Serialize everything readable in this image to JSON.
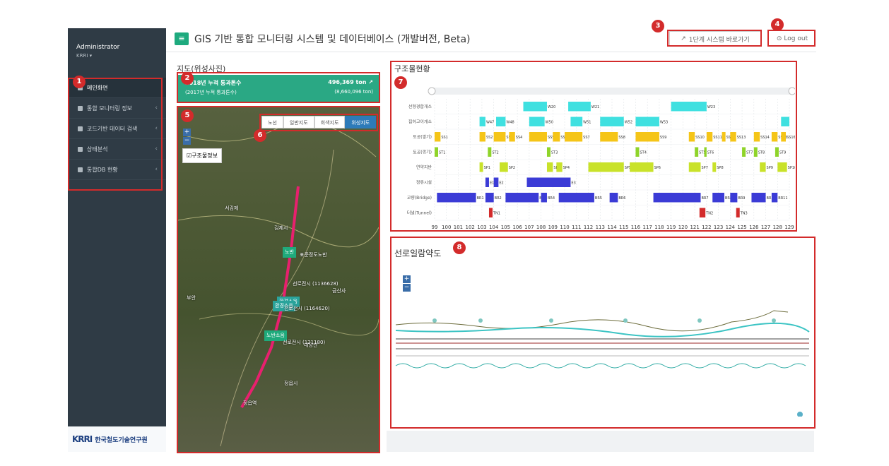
{
  "sidebar": {
    "user_name": "Administrator",
    "user_sub": "KRRI ▾",
    "items": [
      {
        "label": "메인화면"
      },
      {
        "label": "통합 모니터링 정보"
      },
      {
        "label": "코드기반 데이터 검색"
      },
      {
        "label": "상태분석"
      },
      {
        "label": "통합DB 현황"
      }
    ],
    "logo_mark": "KRRI",
    "logo_text": "한국철도기술연구원"
  },
  "header": {
    "menu_icon": "hamburger-icon",
    "title": "GIS 기반 통합 모니터링 시스템 및 데이터베이스 (개발버전, Beta)",
    "shortcut_label": "1단계 시스템 바로가기",
    "logout_label": "Log out"
  },
  "map_section": {
    "title": "지도(위성사진)",
    "stats_label": "2018년 누적 통과톤수",
    "stats_value": "496,369 ton",
    "stats_prev_label": "(2017년 누적 통과톤수)",
    "stats_prev_value": "(8,660,096 ton)",
    "tabs": [
      "노선",
      "일반지도",
      "회색지도",
      "위성지도"
    ],
    "active_tab": "위성지도",
    "checkbox_label": "구조물정보",
    "places": [
      "김제시",
      "정읍시",
      "정읍역",
      "부안",
      "내장산",
      "서김제",
      "금산사"
    ],
    "badges": [
      "노반",
      "환경소음",
      "환경소음",
      "노반소음"
    ],
    "annotations": [
      "표준정도노반",
      "선로전시 (1136628)",
      "선로전시 (1164620)",
      "선로전시 (121180)"
    ]
  },
  "structure_section": {
    "title": "구조물현황"
  },
  "lineplan_section": {
    "title": "선로일람약도"
  },
  "callouts": [
    "1",
    "2",
    "3",
    "4",
    "5",
    "6",
    "7",
    "8"
  ],
  "chart_data": {
    "type": "gantt",
    "x_range": [
      99,
      129
    ],
    "x_ticks": [
      "99",
      "100",
      "101",
      "102",
      "103",
      "104",
      "105",
      "106",
      "107",
      "108",
      "109",
      "110",
      "111",
      "112",
      "113",
      "114",
      "115",
      "116",
      "117",
      "118",
      "119",
      "120",
      "121",
      "122",
      "123",
      "124",
      "125",
      "126",
      "127",
      "128",
      "129"
    ],
    "rows": [
      {
        "name": "선형경합개소",
        "color": "#3fe0e0",
        "items": [
          {
            "label": "W20",
            "start": 106.5,
            "end": 108.5
          },
          {
            "label": "W21",
            "start": 110.3,
            "end": 112.2
          },
          {
            "label": "W23",
            "start": 119,
            "end": 122
          }
        ]
      },
      {
        "name": "집하고이개소",
        "color": "#3fe0e0",
        "items": [
          {
            "label": "W47",
            "start": 102.8,
            "end": 103.3
          },
          {
            "label": "W48",
            "start": 104.2,
            "end": 105
          },
          {
            "label": "W50",
            "start": 107,
            "end": 108.3
          },
          {
            "label": "W51",
            "start": 110.5,
            "end": 111.5
          },
          {
            "label": "W52",
            "start": 113,
            "end": 115
          },
          {
            "label": "W53",
            "start": 116,
            "end": 118
          },
          {
            "label": "",
            "start": 128.3,
            "end": 129
          }
        ]
      },
      {
        "name": "토공(쌓기)",
        "color": "#f5c518",
        "items": [
          {
            "label": "SS1",
            "start": 99,
            "end": 99.5
          },
          {
            "label": "SS2",
            "start": 102.8,
            "end": 103.3
          },
          {
            "label": "SS3",
            "start": 104,
            "end": 105
          },
          {
            "label": "SS4",
            "start": 105.3,
            "end": 105.8
          },
          {
            "label": "SS5",
            "start": 107,
            "end": 108.5
          },
          {
            "label": "SS6",
            "start": 109,
            "end": 109.6
          },
          {
            "label": "SS7",
            "start": 110,
            "end": 111.5
          },
          {
            "label": "SS8",
            "start": 113,
            "end": 114.5
          },
          {
            "label": "SS9",
            "start": 116,
            "end": 118
          },
          {
            "label": "SS10",
            "start": 120.5,
            "end": 121
          },
          {
            "label": "SS11",
            "start": 122,
            "end": 122.5
          },
          {
            "label": "SS12",
            "start": 123.3,
            "end": 123.6
          },
          {
            "label": "SS13",
            "start": 124,
            "end": 124.5
          },
          {
            "label": "SS14",
            "start": 126,
            "end": 126.5
          },
          {
            "label": "SS15",
            "start": 127.5,
            "end": 128
          },
          {
            "label": "SS16",
            "start": 128.3,
            "end": 128.7
          }
        ]
      },
      {
        "name": "토공(깎기)",
        "color": "#8fd42a",
        "items": [
          {
            "label": "ST1",
            "start": 99,
            "end": 99.3
          },
          {
            "label": "ST2",
            "start": 103.5,
            "end": 103.8
          },
          {
            "label": "ST3",
            "start": 108.5,
            "end": 108.8
          },
          {
            "label": "ST4",
            "start": 116,
            "end": 116.3
          },
          {
            "label": "ST5",
            "start": 121,
            "end": 121.3
          },
          {
            "label": "ST6",
            "start": 121.8,
            "end": 122
          },
          {
            "label": "ST7",
            "start": 125,
            "end": 125.3
          },
          {
            "label": "ST8",
            "start": 126,
            "end": 126.3
          },
          {
            "label": "ST9",
            "start": 127.8,
            "end": 128.1
          }
        ]
      },
      {
        "name": "연약지반",
        "color": "#c9e22a",
        "items": [
          {
            "label": "SP1",
            "start": 102.8,
            "end": 103.1
          },
          {
            "label": "SP2",
            "start": 104.5,
            "end": 105.2
          },
          {
            "label": "SP3",
            "start": 108.5,
            "end": 109
          },
          {
            "label": "SP4",
            "start": 109.3,
            "end": 109.8
          },
          {
            "label": "SP5",
            "start": 112,
            "end": 115
          },
          {
            "label": "SP6",
            "start": 115.5,
            "end": 117.5
          },
          {
            "label": "SP7",
            "start": 120.5,
            "end": 121.5
          },
          {
            "label": "SP8",
            "start": 122.5,
            "end": 122.8
          },
          {
            "label": "SP9",
            "start": 126.5,
            "end": 127
          },
          {
            "label": "SP10",
            "start": 128,
            "end": 128.8
          }
        ]
      },
      {
        "name": "정류시설",
        "color": "#3b3bd6",
        "items": [
          {
            "label": "E1",
            "start": 103.3,
            "end": 103.6
          },
          {
            "label": "E2",
            "start": 104,
            "end": 104.4
          },
          {
            "label": "E3",
            "start": 106.8,
            "end": 110.5
          }
        ]
      },
      {
        "name": "교량(Bridge)",
        "color": "#3b3bd6",
        "items": [
          {
            "label": "BR1",
            "start": 99.2,
            "end": 102.5
          },
          {
            "label": "BR2",
            "start": 103.3,
            "end": 104
          },
          {
            "label": "BR3",
            "start": 105,
            "end": 107.8
          },
          {
            "label": "BR4",
            "start": 108,
            "end": 108.5
          },
          {
            "label": "BR5",
            "start": 109.5,
            "end": 112.5
          },
          {
            "label": "BR6",
            "start": 113.8,
            "end": 114.5
          },
          {
            "label": "BR7",
            "start": 117.5,
            "end": 121.5
          },
          {
            "label": "BR8",
            "start": 122.5,
            "end": 123.5
          },
          {
            "label": "BR9",
            "start": 124,
            "end": 124.6
          },
          {
            "label": "BR10",
            "start": 125.8,
            "end": 127
          },
          {
            "label": "BR11",
            "start": 127.5,
            "end": 128
          }
        ]
      },
      {
        "name": "터널(Tunnel)",
        "color": "#d32b2b",
        "items": [
          {
            "label": "TN1",
            "start": 103.6,
            "end": 103.9
          },
          {
            "label": "TN2",
            "start": 121.4,
            "end": 121.9
          },
          {
            "label": "TN3",
            "start": 124.5,
            "end": 124.8
          }
        ]
      }
    ]
  }
}
